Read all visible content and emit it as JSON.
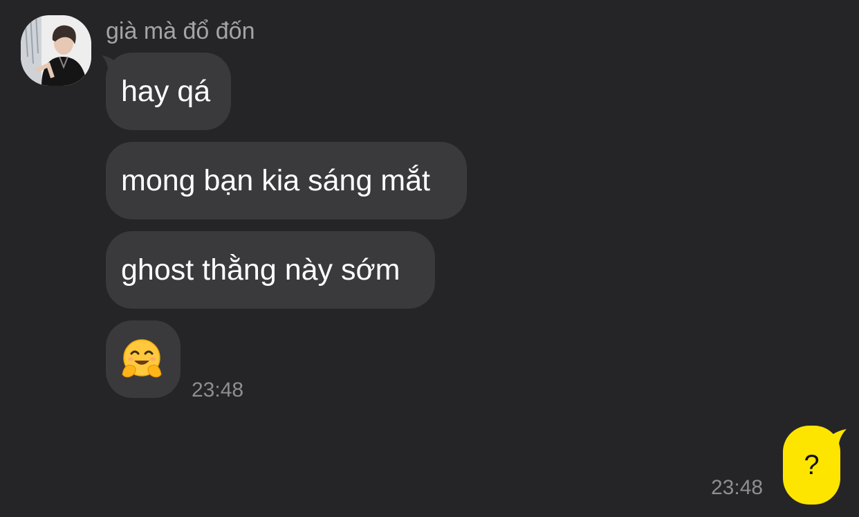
{
  "chat": {
    "incoming": {
      "sender_name": "già mà đổ đốn",
      "messages": [
        {
          "text": "hay qá"
        },
        {
          "text": "mong bạn kia sáng mắt"
        },
        {
          "text": "ghost thằng này sớm"
        },
        {
          "emoji": "hugging-face-emoji"
        }
      ],
      "time": "23:48"
    },
    "outgoing": {
      "text": "?",
      "time": "23:48"
    }
  },
  "colors": {
    "background": "#252527",
    "incoming_bubble": "#3a3a3c",
    "outgoing_bubble": "#fee500",
    "name_text": "#a4a4a8",
    "time_text": "#8e8e93"
  }
}
